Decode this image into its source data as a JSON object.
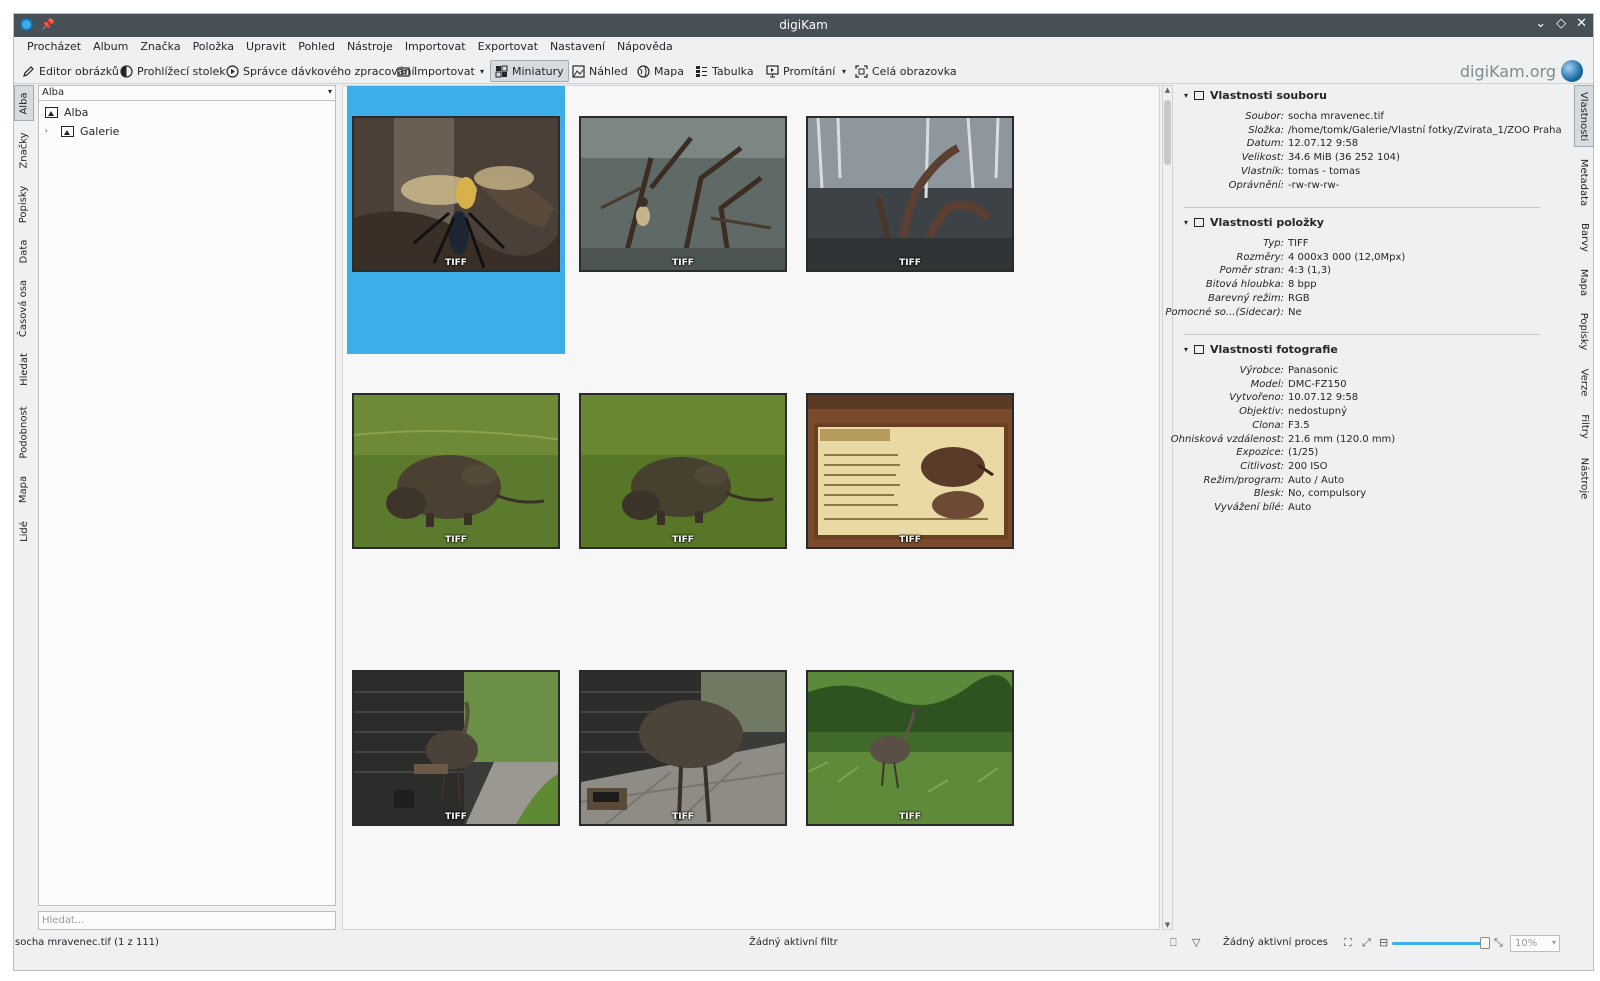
{
  "window": {
    "title": "digiKam"
  },
  "menu": [
    "Procházet",
    "Album",
    "Značka",
    "Položka",
    "Upravit",
    "Pohled",
    "Nástroje",
    "Importovat",
    "Exportovat",
    "Nastavení",
    "Nápověda"
  ],
  "toolbar": {
    "image_editor": "Editor obrázků",
    "light_table": "Prohlížecí stolek",
    "batch_queue": "Správce dávkového zpracování",
    "import": "Importovat",
    "thumbnails": "Miniatury",
    "preview": "Náhled",
    "map": "Mapa",
    "table": "Tabulka",
    "slideshow": "Promítání",
    "fullscreen": "Celá obrazovka",
    "brand": "digiKam.org"
  },
  "left_tabs": [
    "Alba",
    "Značky",
    "Popisky",
    "Data",
    "Časová osa",
    "Hledat",
    "Podobnost",
    "Mapa",
    "Lidé"
  ],
  "album_panel": {
    "combo": "Alba",
    "tree": [
      {
        "label": "Alba",
        "level": 0
      },
      {
        "label": "Galerie",
        "level": 1
      }
    ],
    "search_placeholder": "Hledat..."
  },
  "thumbnails": {
    "badge": "TIFF",
    "items": [
      {
        "subject": "wasp-sculpture",
        "selected": true
      },
      {
        "subject": "monkey-branches",
        "selected": false
      },
      {
        "subject": "monkey-waterfall",
        "selected": false
      },
      {
        "subject": "capybara-grass-1",
        "selected": false
      },
      {
        "subject": "capybara-grass-2",
        "selected": false
      },
      {
        "subject": "zoo-info-sign",
        "selected": false
      },
      {
        "subject": "emu-shed-1",
        "selected": false
      },
      {
        "subject": "emu-shed-2",
        "selected": false
      },
      {
        "subject": "emu-meadow",
        "selected": false
      }
    ]
  },
  "right_tabs": [
    "Vlastnosti",
    "Metadata",
    "Barvy",
    "Mapa",
    "Popisky",
    "Verze",
    "Filtry",
    "Nástroje"
  ],
  "properties": {
    "file_section": {
      "title": "Vlastnosti souboru",
      "rows": [
        {
          "label": "Soubor:",
          "value": "socha mravenec.tif"
        },
        {
          "label": "Složka:",
          "value": "/home/tomk/Galerie/Vlastní fotky/Zvirata_1/ZOO Praha"
        },
        {
          "label": "Datum:",
          "value": "12.07.12 9:58"
        },
        {
          "label": "Velikost:",
          "value": "34.6 MiB (36 252 104)"
        },
        {
          "label": "Vlastník:",
          "value": "tomas - tomas"
        },
        {
          "label": "Oprávnění:",
          "value": "-rw-rw-rw-"
        }
      ]
    },
    "item_section": {
      "title": "Vlastnosti položky",
      "rows": [
        {
          "label": "Typ:",
          "value": "TIFF"
        },
        {
          "label": "Rozměry:",
          "value": "4 000x3 000 (12,0Mpx)"
        },
        {
          "label": "Poměr stran:",
          "value": "4:3 (1,3)"
        },
        {
          "label": "Bitová hloubka:",
          "value": "8 bpp"
        },
        {
          "label": "Barevný režim:",
          "value": "RGB"
        },
        {
          "label": "Pomocné so...(Sidecar):",
          "value": "Ne"
        }
      ]
    },
    "photo_section": {
      "title": "Vlastnosti fotografie",
      "rows": [
        {
          "label": "Výrobce:",
          "value": "Panasonic"
        },
        {
          "label": "Model:",
          "value": "DMC-FZ150"
        },
        {
          "label": "Vytvořeno:",
          "value": "10.07.12 9:58"
        },
        {
          "label": "Objektiv:",
          "value": "nedostupný"
        },
        {
          "label": "Clona:",
          "value": "F3.5"
        },
        {
          "label": "Ohnisková vzdálenost:",
          "value": "21.6 mm (120.0 mm)"
        },
        {
          "label": "Expozice:",
          "value": "(1/25)"
        },
        {
          "label": "Citlivost:",
          "value": "200 ISO"
        },
        {
          "label": "Režim/program:",
          "value": "Auto / Auto"
        },
        {
          "label": "Blesk:",
          "value": "No, compulsory"
        },
        {
          "label": "Vyvážení bílé:",
          "value": "Auto"
        }
      ]
    }
  },
  "status": {
    "selection": "socha mravenec.tif (1 z 111)",
    "filter": "Žádný aktivní filtr",
    "process": "Žádný aktivní proces",
    "zoom": "10%"
  },
  "colors": {
    "accent": "#3daee9",
    "titlebar": "#475057",
    "window": "#eff0f1"
  }
}
